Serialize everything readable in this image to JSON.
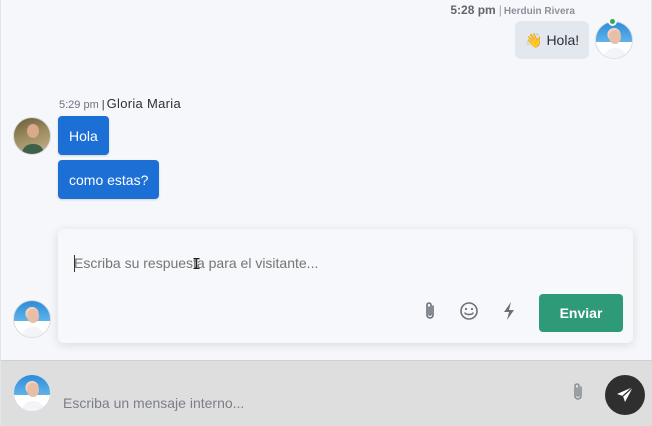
{
  "agent_message": {
    "time": "5:28 pm",
    "separator": "|",
    "author": "Herduin Rivera",
    "emoji": "👋",
    "text": "Hola!"
  },
  "visitor_block": {
    "time": "5:29 pm",
    "separator": "|",
    "author": "Gloria Maria",
    "messages": [
      "Hola",
      "como estas?"
    ]
  },
  "composer": {
    "placeholder": "Escriba su respuesta para el visitante...",
    "send_label": "Enviar",
    "tools": [
      "paperclip-icon",
      "emoji-icon",
      "lightning-icon"
    ]
  },
  "internal_bar": {
    "placeholder": "Escriba un mensaje interno..."
  },
  "colors": {
    "visitor_bubble": "#1c6fd4",
    "agent_bubble": "#e3e8ee",
    "send_button": "#2e9a78",
    "online": "#34a853",
    "internal_bar": "#dedede"
  }
}
